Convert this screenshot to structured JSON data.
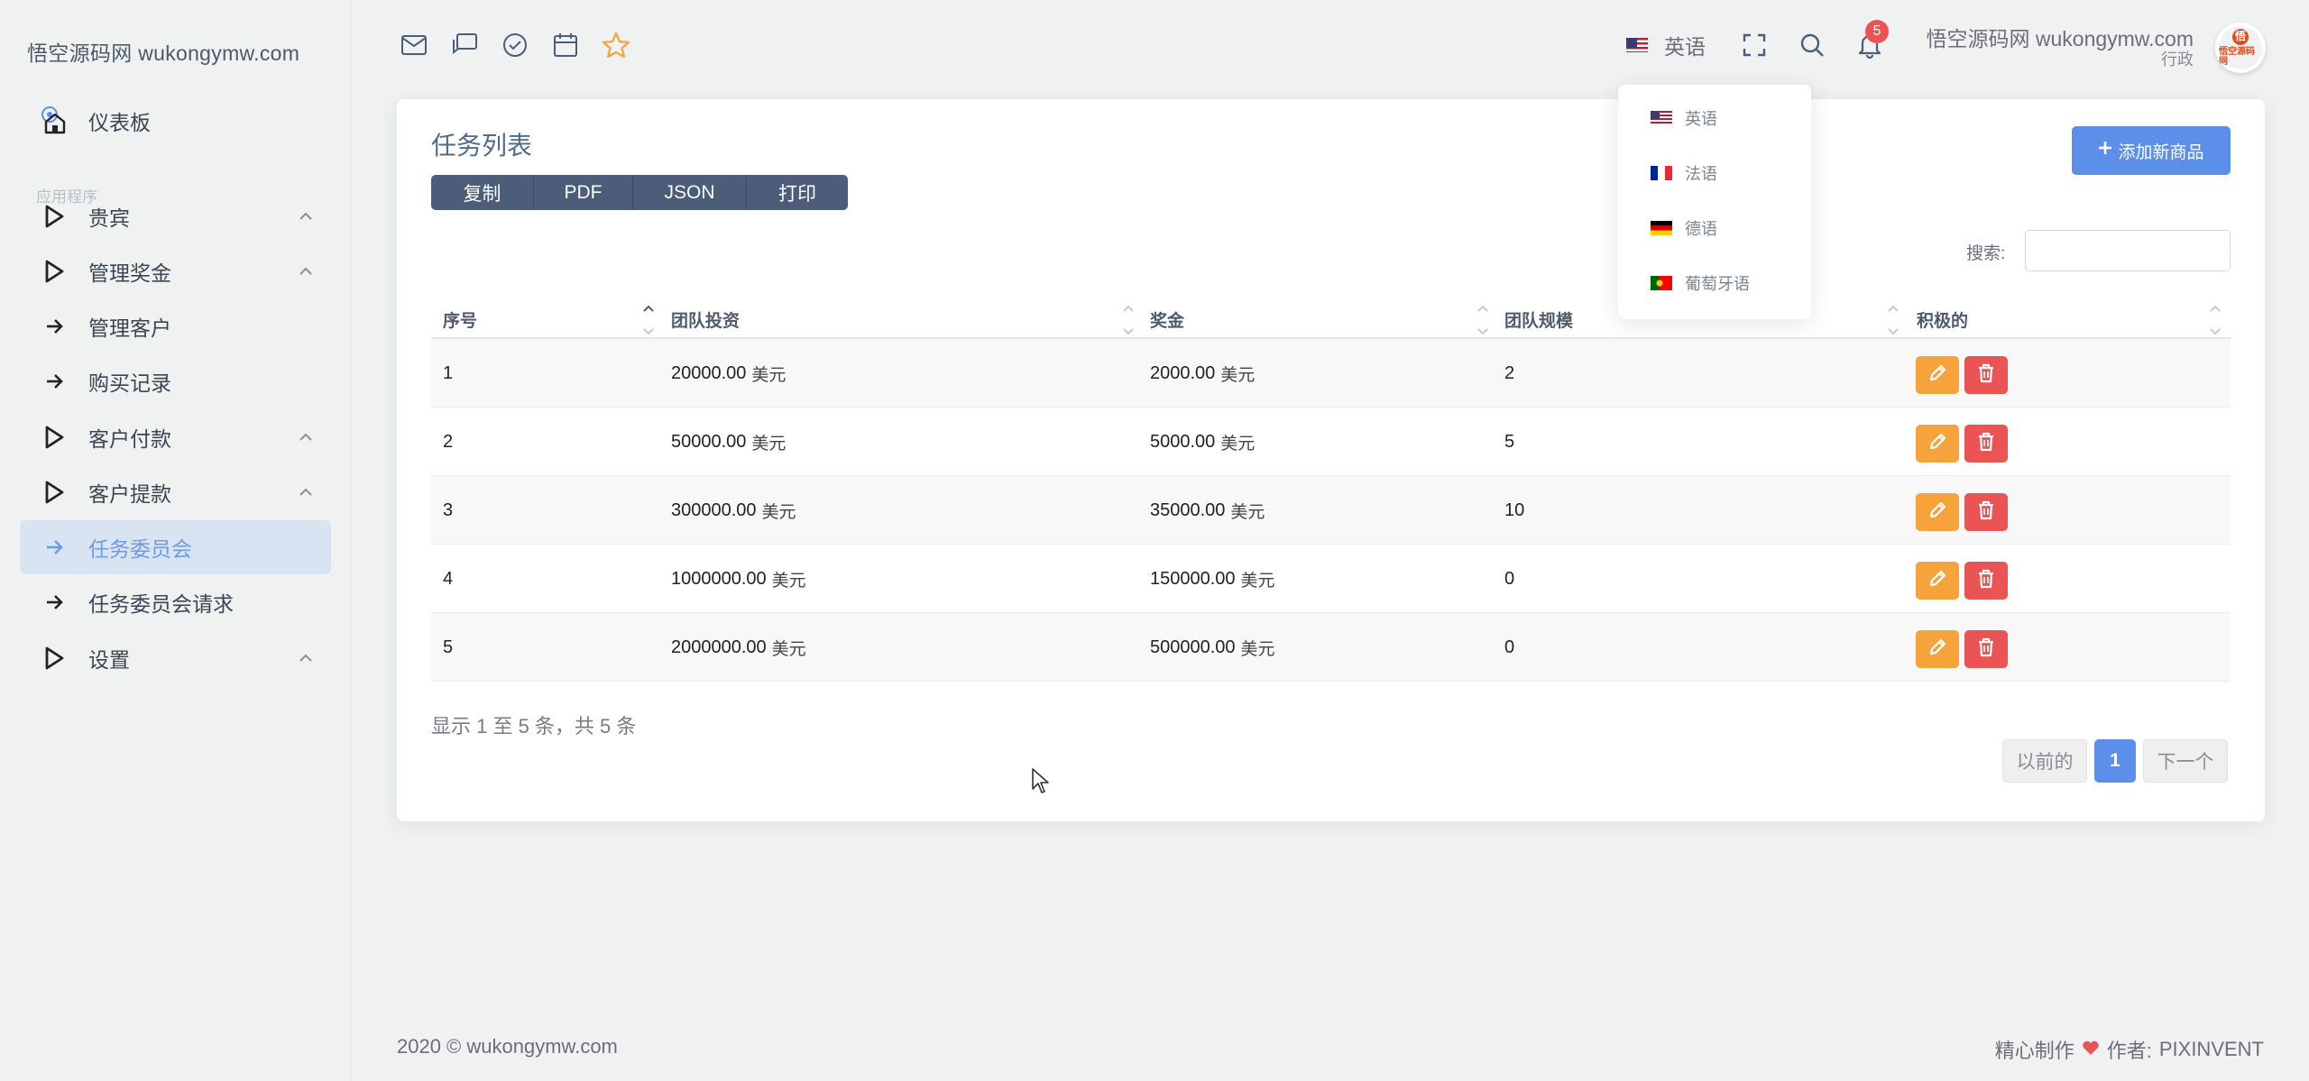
{
  "brand": "悟空源码网 wukongymw.com",
  "sidebar": {
    "dashboard": "仪表板",
    "section": "应用程序",
    "items": [
      {
        "label": "贵宾",
        "icon": "play-icon",
        "expandable": true
      },
      {
        "label": "管理奖金",
        "icon": "play-icon",
        "expandable": true
      },
      {
        "label": "管理客户",
        "icon": "arrow-right-icon",
        "expandable": false
      },
      {
        "label": "购买记录",
        "icon": "arrow-right-icon",
        "expandable": false
      },
      {
        "label": "客户付款",
        "icon": "play-icon",
        "expandable": true
      },
      {
        "label": "客户提款",
        "icon": "play-icon",
        "expandable": true
      },
      {
        "label": "任务委员会",
        "icon": "arrow-right-icon",
        "expandable": false,
        "active": true
      },
      {
        "label": "任务委员会请求",
        "icon": "arrow-right-icon",
        "expandable": false
      },
      {
        "label": "设置",
        "icon": "play-icon",
        "expandable": true
      }
    ]
  },
  "header": {
    "icons": [
      "mail-icon",
      "chat-icon",
      "check-circle-icon",
      "calendar-icon",
      "star-icon"
    ],
    "language": "英语",
    "notification_count": "5",
    "user_name": "悟空源码网 wukongymw.com",
    "user_role": "行政"
  },
  "language_menu": [
    {
      "label": "英语",
      "flag": "us-flag"
    },
    {
      "label": "法语",
      "flag": "fr-flag"
    },
    {
      "label": "德语",
      "flag": "de-flag"
    },
    {
      "label": "葡萄牙语",
      "flag": "pt-flag"
    }
  ],
  "card": {
    "title": "任务列表",
    "export_buttons": [
      "复制",
      "PDF",
      "JSON",
      "打印"
    ],
    "add_button": "添加新商品",
    "search_label": "搜索:",
    "search_value": ""
  },
  "table": {
    "columns": [
      "序号",
      "团队投资",
      "奖金",
      "团队规模",
      "积极的"
    ],
    "rows": [
      {
        "id": "1",
        "investment": "20000.00",
        "bonus": "2000.00",
        "size": "2"
      },
      {
        "id": "2",
        "investment": "50000.00",
        "bonus": "5000.00",
        "size": "5"
      },
      {
        "id": "3",
        "investment": "300000.00",
        "bonus": "35000.00",
        "size": "10"
      },
      {
        "id": "4",
        "investment": "1000000.00",
        "bonus": "150000.00",
        "size": "0"
      },
      {
        "id": "5",
        "investment": "2000000.00",
        "bonus": "500000.00",
        "size": "0"
      }
    ],
    "unit": "美元"
  },
  "info_text": "显示 1 至 5 条，共 5 条",
  "pagination": {
    "prev": "以前的",
    "current": "1",
    "next": "下一个"
  },
  "footer": {
    "copyright": "2020 © wukongymw.com",
    "made_with": "精心制作",
    "author_label": "作者:",
    "author": "PIXINVENT"
  },
  "colors": {
    "accent": "#5b8fea",
    "edit": "#f6a33b",
    "delete": "#ea5455",
    "export": "#4b5d78"
  }
}
